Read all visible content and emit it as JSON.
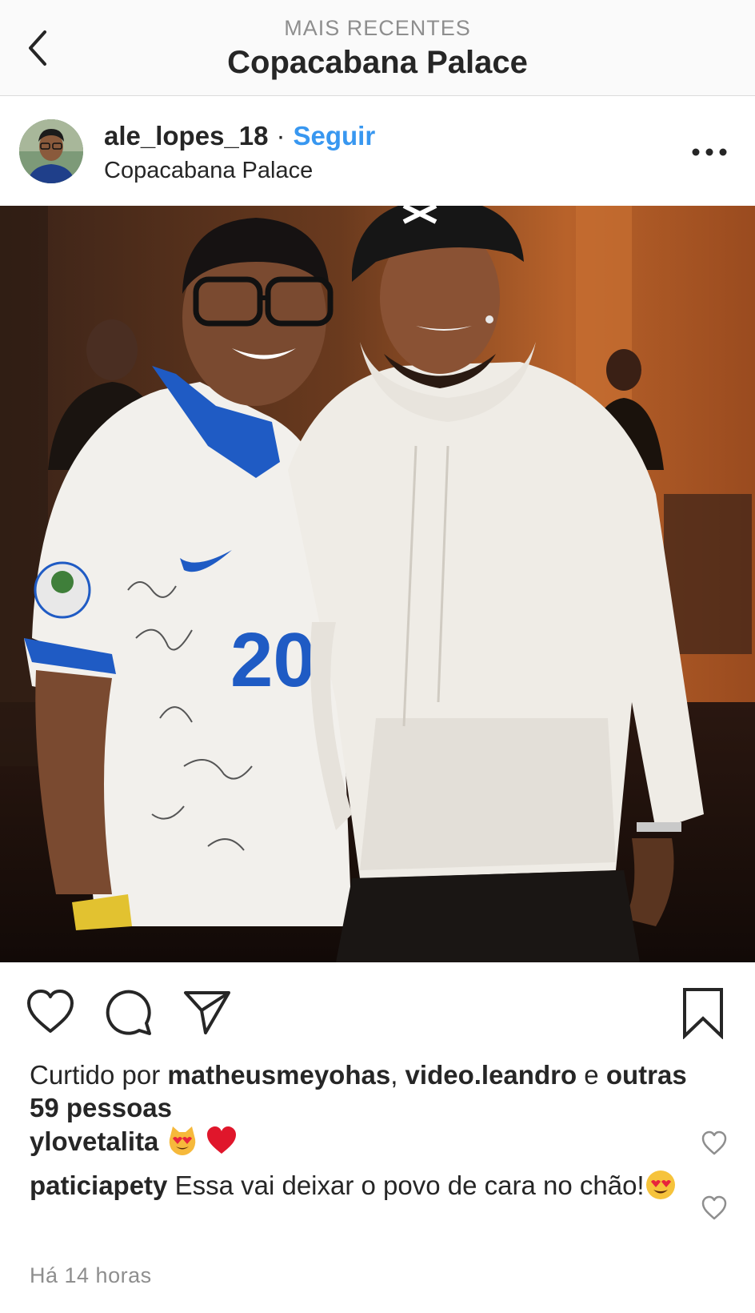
{
  "header": {
    "subtitle": "MAIS RECENTES",
    "title": "Copacabana Palace"
  },
  "post": {
    "username": "ale_lopes_18",
    "separator": "·",
    "follow_label": "Seguir",
    "location": "Copacabana Palace",
    "jersey_number": "20",
    "likes": {
      "prefix": "Curtido por",
      "user1": "matheusmeyohas",
      "comma": ",",
      "user2": "video.leandro",
      "conj": "e",
      "others": "outras 59 pessoas"
    },
    "comments": [
      {
        "user": "ylovetalita",
        "text": "",
        "emoji": [
          "heart-eyes-cat",
          "red-heart"
        ]
      },
      {
        "user": "paticiapety",
        "text": "Essa vai deixar o povo de cara no chão!",
        "emoji": [
          "heart-eyes-face"
        ]
      }
    ],
    "time": "Há 14 horas"
  },
  "icons": {
    "back": "chevron-left-icon",
    "more": "more-horizontal-icon",
    "like": "heart-icon",
    "comment": "comment-icon",
    "share": "paper-plane-icon",
    "save": "bookmark-icon"
  },
  "colors": {
    "link_blue": "#3897f0",
    "text": "#262626",
    "muted": "#8e8e8e",
    "divider": "#dbdbdb",
    "header_bg": "#fafafa"
  }
}
